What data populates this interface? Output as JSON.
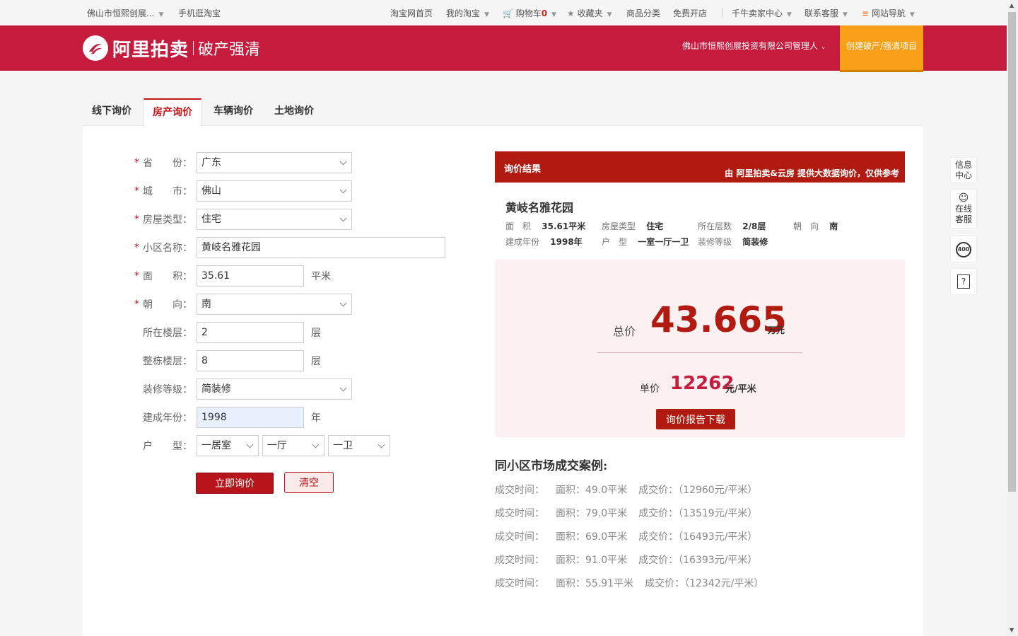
{
  "topbar": {
    "store": "佛山市恒熙创展...",
    "mobile": "手机逛淘宝",
    "taobao_home": "淘宝网首页",
    "my_taobao": "我的淘宝",
    "cart": "购物车",
    "cart_count": "0",
    "favorites": "收藏夹",
    "categories": "商品分类",
    "open_store": "免费开店",
    "seller_center": "千牛卖家中心",
    "customer_service": "联系客服",
    "site_nav": "网站导航"
  },
  "header": {
    "logo_text": "阿里拍卖",
    "logo_sub": "破产强清",
    "manager": "佛山市恒熙创展投资有限公司管理人",
    "create_button": "创建破产/强清项目"
  },
  "tabs": [
    {
      "label": "线下询价"
    },
    {
      "label": "房产询价"
    },
    {
      "label": "车辆询价"
    },
    {
      "label": "土地询价"
    }
  ],
  "form": {
    "province_label": "省　　份：",
    "province_value": "广东",
    "city_label": "城　　市：",
    "city_value": "佛山",
    "house_type_label": "房屋类型：",
    "house_type_value": "住宅",
    "estate_label": "小区名称：",
    "estate_value": "黄岐名雅花园",
    "area_label": "面　　积：",
    "area_value": "35.61",
    "area_unit": "平米",
    "orientation_label": "朝　　向：",
    "orientation_value": "南",
    "floor_label": "所在楼层：",
    "floor_value": "2",
    "floor_unit": "层",
    "total_floor_label": "整栋楼层：",
    "total_floor_value": "8",
    "total_floor_unit": "层",
    "decoration_label": "装修等级：",
    "decoration_value": "简装修",
    "year_label": "建成年份：",
    "year_value": "1998",
    "year_unit": "年",
    "layout_label": "户　　型：",
    "room_value": "一居室",
    "hall_value": "一厅",
    "bath_value": "一卫",
    "submit": "立即询价",
    "clear": "清空"
  },
  "result": {
    "title": "询价结果",
    "source": "由 阿里拍卖&云房 提供大数据询价，仅供参考",
    "estate": "黄岐名雅花园",
    "area_k": "面　积",
    "area_v": "35.61平米",
    "type_k": "房屋类型",
    "type_v": "住宅",
    "floor_k": "所在层数",
    "floor_v": "2/8层",
    "orient_k": "朝　向",
    "orient_v": "南",
    "year_k": "建成年份",
    "year_v": "1998年",
    "layout_k": "户　型",
    "layout_v": "一室一厅一卫",
    "deco_k": "装修等级",
    "deco_v": "简装修",
    "total_label": "总价",
    "total_value": "43.665",
    "total_unit": "万元",
    "unit_label": "单价",
    "unit_value": "12262",
    "unit_unit": "元/平米",
    "report_button": "询价报告下载"
  },
  "cases": {
    "title": "同小区市场成交案例:",
    "items": [
      {
        "time": "成交时间：",
        "area": "面积：49.0平米",
        "price": "成交价：（12960元/平米）"
      },
      {
        "time": "成交时间：",
        "area": "面积：79.0平米",
        "price": "成交价：（13519元/平米）"
      },
      {
        "time": "成交时间：",
        "area": "面积：69.0平米",
        "price": "成交价：（16493元/平米）"
      },
      {
        "time": "成交时间：",
        "area": "面积：91.0平米",
        "price": "成交价：（16393元/平米）"
      },
      {
        "time": "成交时间：",
        "area": "面积：55.91平米",
        "price": "成交价：（12342元/平米）"
      }
    ]
  },
  "floatbar": {
    "info": "信息中心",
    "online": "在线客服",
    "hotline": "400",
    "help": "?"
  },
  "colors": {
    "header_red": "#c51c3e",
    "result_red": "#b01a10",
    "accent_orange": "#f9a01b"
  }
}
